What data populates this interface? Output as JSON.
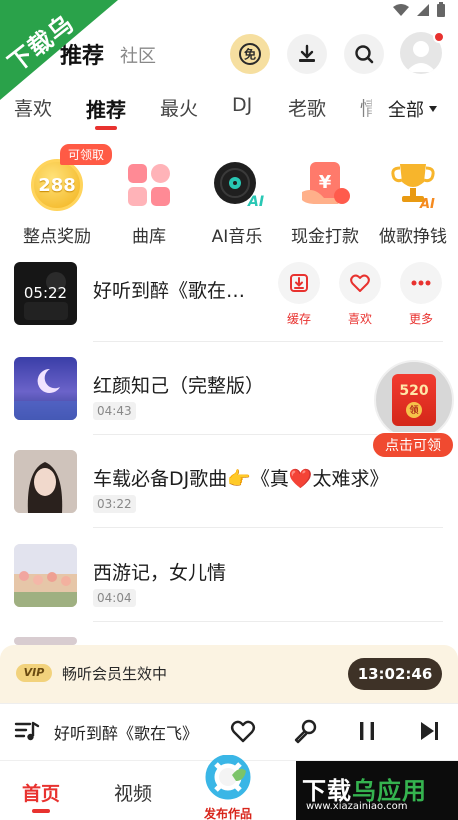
{
  "watermark": {
    "corner_text": "下载乌",
    "banner_main_a": "下载",
    "banner_main_b": "乌应用",
    "banner_url": "www.xiazainiao.com"
  },
  "header": {
    "title": "推荐",
    "subtitle": "社区",
    "icons": [
      "vip-free-icon",
      "download-icon",
      "search-icon"
    ]
  },
  "tabs": {
    "items": [
      "喜欢",
      "推荐",
      "最火",
      "DJ",
      "老歌",
      "情"
    ],
    "active_index": 1,
    "all_label": "全部"
  },
  "shortcuts": {
    "claim_badge": "可领取",
    "items": [
      {
        "label": "整点奖励",
        "coin_value": "288",
        "icon": "coin-icon"
      },
      {
        "label": "曲库",
        "icon": "library-grid-icon"
      },
      {
        "label": "AI音乐",
        "icon": "ai-vinyl-icon"
      },
      {
        "label": "现金打款",
        "icon": "cash-payout-icon"
      },
      {
        "label": "做歌挣钱",
        "icon": "trophy-ai-icon"
      }
    ]
  },
  "songs": [
    {
      "title": "好听到醉《歌在…",
      "duration": "05:22",
      "playing": true,
      "actions": [
        {
          "label": "缓存",
          "icon": "cache-download-icon"
        },
        {
          "label": "喜欢",
          "icon": "heart-icon"
        },
        {
          "label": "更多",
          "icon": "more-dots-icon"
        }
      ]
    },
    {
      "title": "红颜知己（完整版）",
      "duration": "04:43"
    },
    {
      "title": "车载必备DJ歌曲👉《真❤️太难求》",
      "duration": "03:22"
    },
    {
      "title": "西游记，女儿情",
      "duration": "04:04"
    }
  ],
  "float_packet": {
    "amount": "520",
    "sub": "领",
    "label": "点击可领"
  },
  "vip_bar": {
    "tag": "VIP",
    "text": "畅听会员生效中",
    "timer": "13:02:46"
  },
  "player": {
    "title": "好听到醉《歌在飞》"
  },
  "bottom_nav": {
    "items": [
      "首页",
      "视频"
    ],
    "active_index": 0,
    "publish_label": "发布作品"
  },
  "colors": {
    "accent": "#e8322f",
    "vip_bg": "#fbf3e2",
    "timer_bg": "#3e3227",
    "watermark_green": "#2aa24a"
  }
}
